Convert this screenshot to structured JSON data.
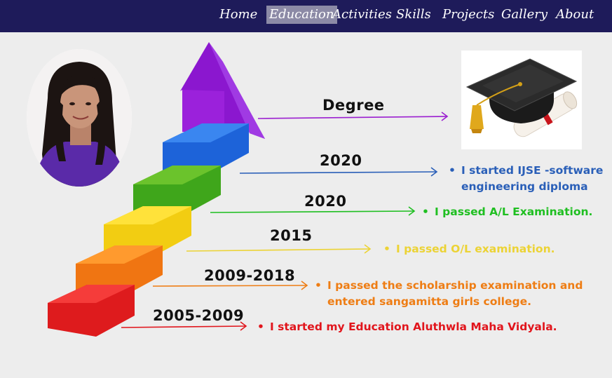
{
  "nav": {
    "items": [
      "Home",
      "Education",
      "Activities",
      "Skills",
      "Projects",
      "Gallery",
      "About"
    ],
    "active": "Education"
  },
  "timeline": [
    {
      "year": "Degree",
      "text": [],
      "color": "#9b1fd0"
    },
    {
      "year": "2020",
      "text": [
        "I started IJSE -software",
        "engineering diploma"
      ],
      "color": "#2a5fb8"
    },
    {
      "year": "2020",
      "text": [
        "I passed A/L Examination."
      ],
      "color": "#1fbf21"
    },
    {
      "year": "2015",
      "text": [
        "I passed O/L examination."
      ],
      "color": "#ecd335"
    },
    {
      "year": "2009-2018",
      "text": [
        "I passed  the scholarship examination and",
        "entered sangamitta girls college."
      ],
      "color": "#ee7d14"
    },
    {
      "year": "2005-2009",
      "text": [
        "I started my Education Aluthwla Maha Vidyala."
      ],
      "color": "#e1151c"
    }
  ],
  "bullet_symbol": "•"
}
